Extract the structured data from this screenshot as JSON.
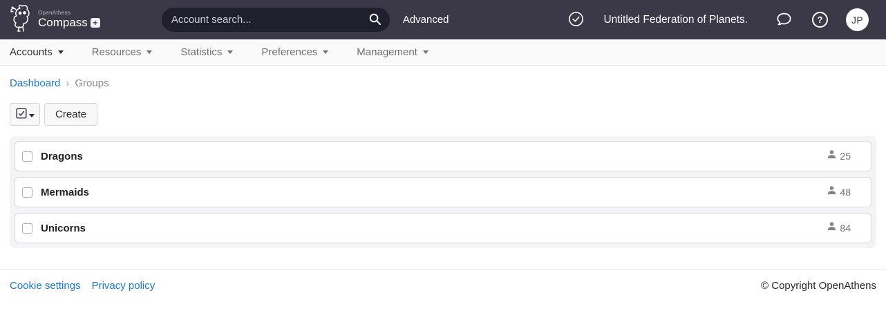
{
  "header": {
    "logo": {
      "brand_small": "OpenAthens",
      "brand_large": "Compass",
      "badge": "+"
    },
    "search": {
      "placeholder": "Account search..."
    },
    "advanced_label": "Advanced",
    "federation_name": "Untitled Federation of Planets.",
    "avatar_initials": "JP"
  },
  "nav": {
    "items": [
      {
        "label": "Accounts",
        "active": true
      },
      {
        "label": "Resources",
        "active": false
      },
      {
        "label": "Statistics",
        "active": false
      },
      {
        "label": "Preferences",
        "active": false
      },
      {
        "label": "Management",
        "active": false
      }
    ]
  },
  "breadcrumb": {
    "dashboard": "Dashboard",
    "separator": "›",
    "current": "Groups"
  },
  "toolbar": {
    "create_label": "Create"
  },
  "groups": [
    {
      "name": "Dragons",
      "count": "25"
    },
    {
      "name": "Mermaids",
      "count": "48"
    },
    {
      "name": "Unicorns",
      "count": "84"
    }
  ],
  "footer": {
    "cookie_label": "Cookie settings",
    "privacy_label": "Privacy policy",
    "copyright": "© Copyright OpenAthens"
  },
  "icons": {
    "owl-logo-icon": "owl line-art",
    "search-icon": "magnifier",
    "check-circle-icon": "checkmark in circle",
    "chat-icon": "speech bubble",
    "help-icon": "question mark in circle",
    "caret-down-icon": "▾",
    "checkbox-checked-icon": "☑",
    "person-icon": "person silhouette",
    "breadcrumb-separator-icon": "›"
  },
  "colors": {
    "header_bg": "#3b3847",
    "search_pill_bg": "#20202c",
    "nav_bg": "#fafafa",
    "panel_bg": "#f4f4f6",
    "link_blue": "#1a77d2",
    "row_border": "#dadade",
    "muted_text": "#71717a"
  }
}
